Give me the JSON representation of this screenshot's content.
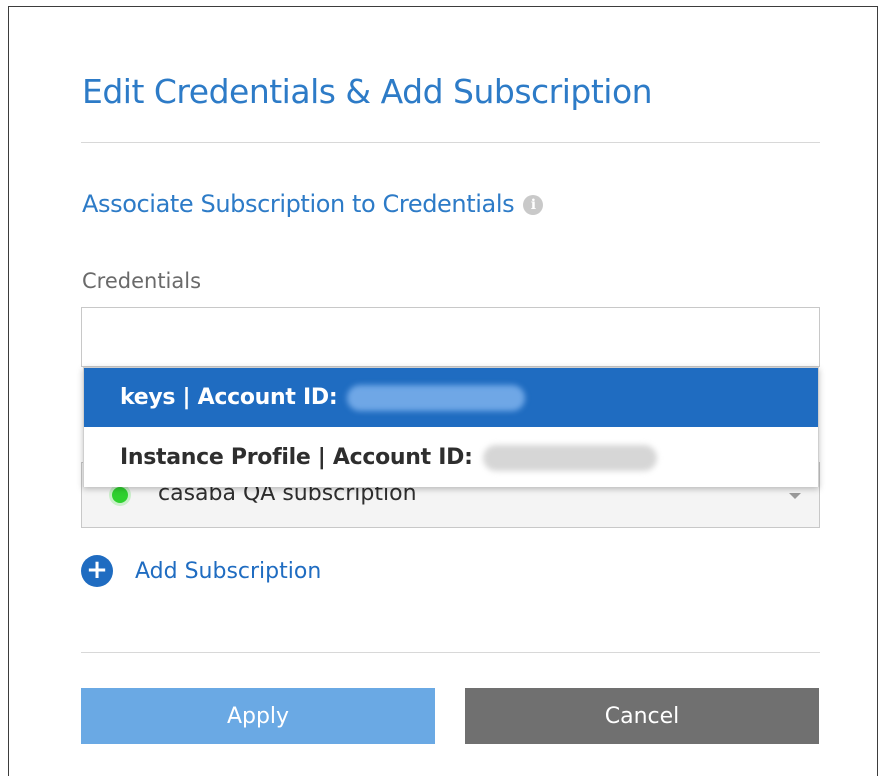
{
  "dialog": {
    "title": "Edit Credentials & Add Subscription",
    "section_title": "Associate Subscription to Credentials",
    "credentials_label": "Credentials"
  },
  "credentials_dropdown": {
    "items": [
      {
        "label": "keys | Account ID:",
        "selected": true
      },
      {
        "label": "Instance Profile | Account ID:",
        "selected": false
      }
    ]
  },
  "subscription_select": {
    "value": "casaba QA subscription",
    "status_color": "#2fd12f"
  },
  "add_subscription": {
    "label": "Add Subscription",
    "icon": "plus-circle-icon"
  },
  "buttons": {
    "apply_label": "Apply",
    "cancel_label": "Cancel"
  },
  "colors": {
    "accent": "#2d7bc7",
    "selected_row": "#1f6cc1",
    "apply_button": "#6aa9e4",
    "cancel_button": "#707070"
  }
}
